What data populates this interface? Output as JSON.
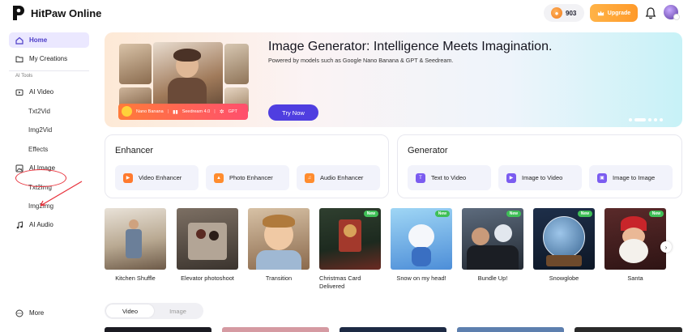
{
  "app": {
    "name": "HitPaw Online"
  },
  "header": {
    "credits": "903",
    "upgrade_label": "Upgrade"
  },
  "sidebar": {
    "home": "Home",
    "my_creations": "My Creations",
    "section_label": "AI Tools",
    "ai_video": "AI Video",
    "txt2vid": "Txt2Vid",
    "img2vid": "Img2Vid",
    "effects": "Effects",
    "ai_image": "AI Image",
    "txt2img": "Txt2Img",
    "img2img": "Img2Img",
    "ai_audio": "AI Audio",
    "more": "More"
  },
  "hero": {
    "title": "Image Generator: Intelligence Meets Imagination.",
    "subtitle": "Powered by models such as Google Nano Banana & GPT & Seedream.",
    "cta": "Try Now",
    "models": [
      "Nano Banana",
      "Seedream 4.0",
      "GPT"
    ]
  },
  "enhancer": {
    "title": "Enhancer",
    "tools": [
      "Video Enhancer",
      "Photo Enhancer",
      "Audio Enhancer"
    ]
  },
  "generator": {
    "title": "Generator",
    "tools": [
      "Text to Video",
      "Image to Video",
      "Image to Image"
    ]
  },
  "templates": [
    {
      "label": "Kitchen Shuffle",
      "new": false
    },
    {
      "label": "Elevator photoshoot",
      "new": false
    },
    {
      "label": "Transition",
      "new": false
    },
    {
      "label": "Christmas Card Delivered",
      "new": true
    },
    {
      "label": "Snow on my head!",
      "new": true
    },
    {
      "label": "Bundle Up!",
      "new": true
    },
    {
      "label": "Snowglobe",
      "new": true
    },
    {
      "label": "Santa",
      "new": true
    }
  ],
  "new_badge": "New",
  "tabs": {
    "video": "Video",
    "image": "Image",
    "active": "video"
  },
  "colors": {
    "accent": "#4f3ee0",
    "upgrade": "#ff9a2a",
    "new_badge": "#3fbf57",
    "annotation": "#e8323c"
  }
}
